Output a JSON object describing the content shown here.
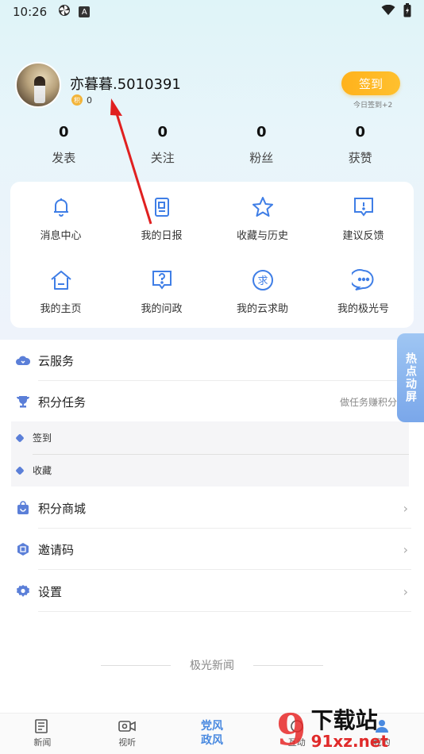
{
  "status_bar": {
    "time": "10:26"
  },
  "profile": {
    "username": "亦暮暮.5010391",
    "points": "0",
    "points_badge": "积",
    "signin_label": "签到",
    "signin_note": "今日签到+2"
  },
  "stats": [
    {
      "num": "0",
      "label": "发表"
    },
    {
      "num": "0",
      "label": "关注"
    },
    {
      "num": "0",
      "label": "粉丝"
    },
    {
      "num": "0",
      "label": "获赞"
    }
  ],
  "grid": [
    {
      "label": "消息中心",
      "icon": "bell-icon"
    },
    {
      "label": "我的日报",
      "icon": "daily-report-icon"
    },
    {
      "label": "收藏与历史",
      "icon": "star-icon"
    },
    {
      "label": "建议反馈",
      "icon": "feedback-icon"
    },
    {
      "label": "我的主页",
      "icon": "home-icon"
    },
    {
      "label": "我的问政",
      "icon": "question-icon"
    },
    {
      "label": "我的云求助",
      "icon": "help-icon"
    },
    {
      "label": "我的极光号",
      "icon": "chat-icon"
    }
  ],
  "menu": {
    "cloud_service": "云服务",
    "points_task": "积分任务",
    "points_task_hint": "做任务赚积分",
    "sub_items": [
      "签到",
      "收藏"
    ],
    "points_mall": "积分商城",
    "invite_code": "邀请码",
    "settings": "设置"
  },
  "hot_tab": "热点动屏",
  "footer_brand": "极光新闻",
  "bottom_nav": {
    "news": "新闻",
    "video": "视听",
    "center_line1": "党风",
    "center_line2": "政风",
    "interact": "互动",
    "mine": "我的"
  },
  "watermark": {
    "top": "下载站",
    "url": "91xz.net",
    "nine": "9"
  },
  "colors": {
    "accent": "#4a8ae0",
    "signin": "#ffb21c",
    "icon_blue": "#3f7ee6"
  }
}
